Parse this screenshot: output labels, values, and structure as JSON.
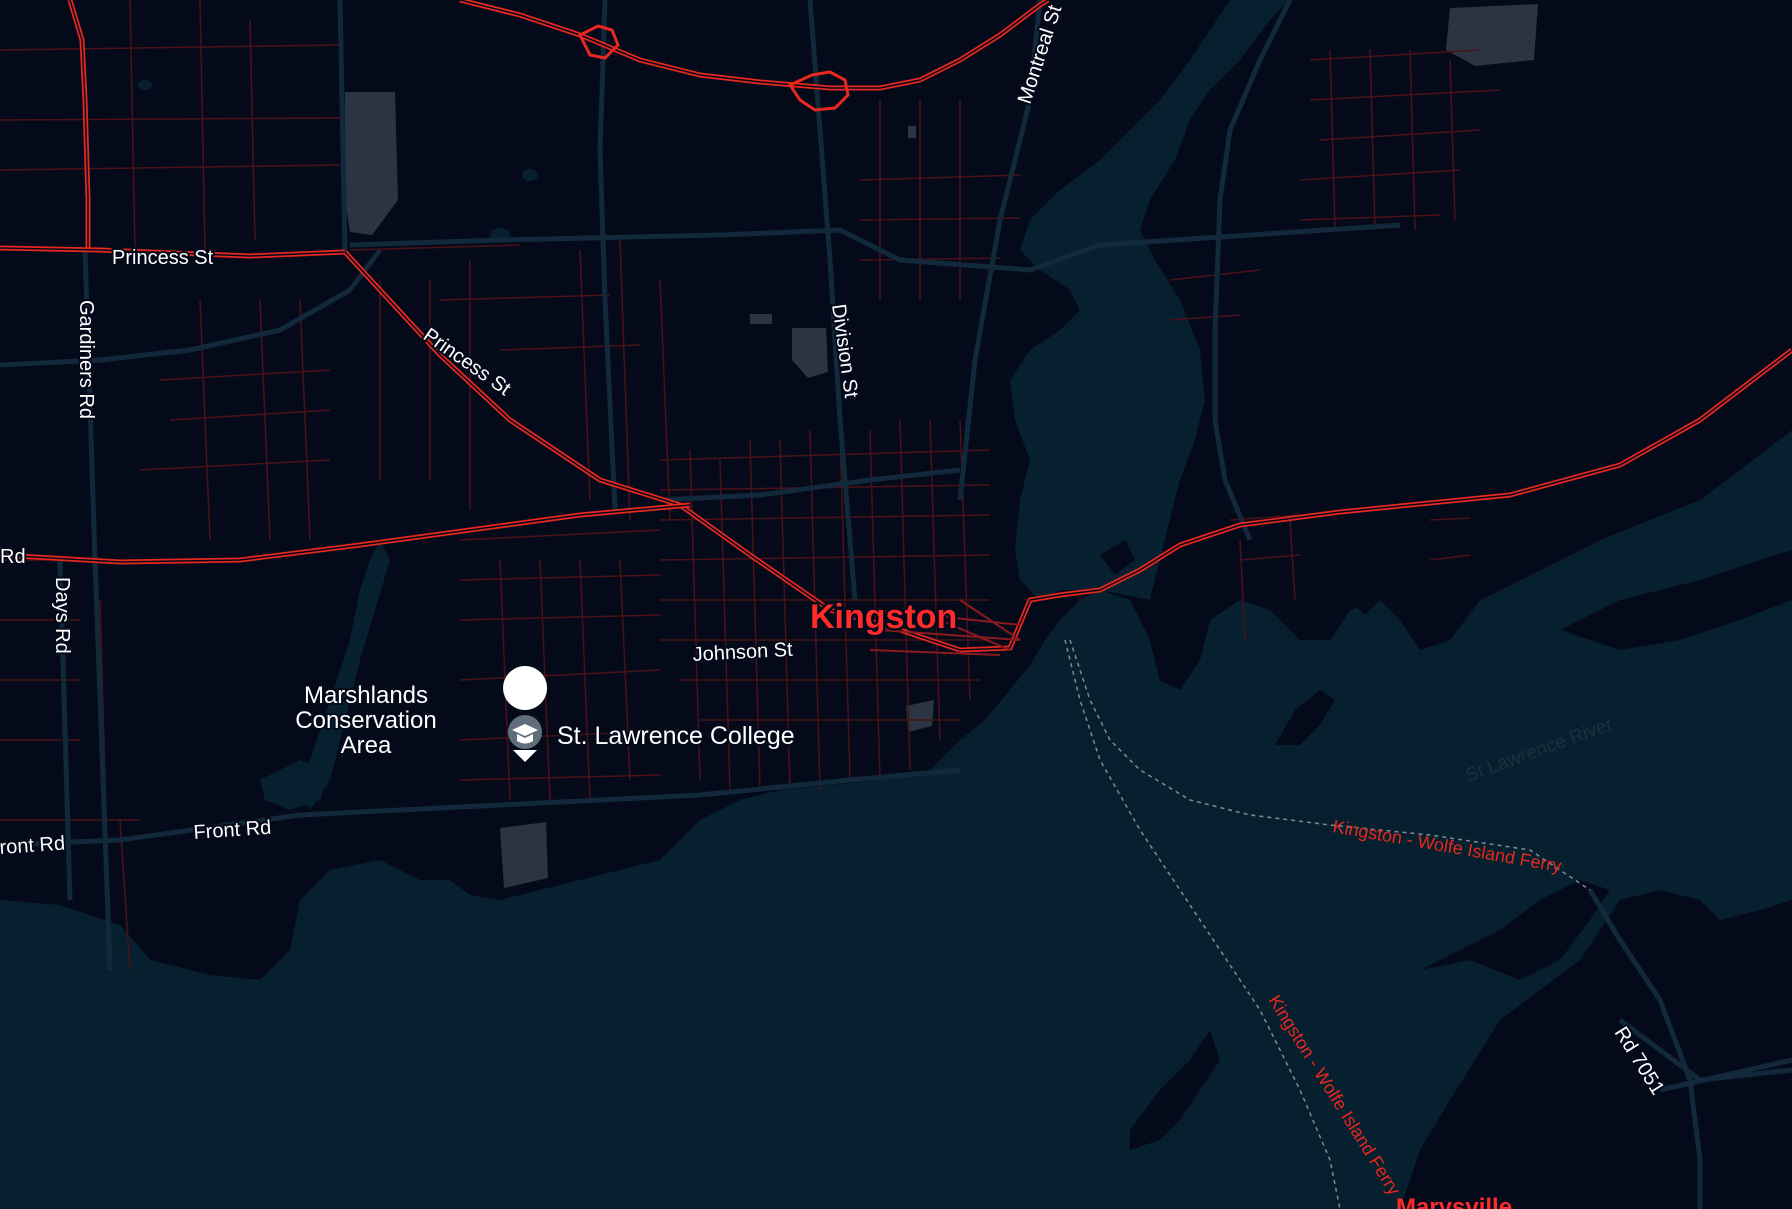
{
  "map": {
    "colors": {
      "land": "#050a1a",
      "water": "#06202f",
      "park": "#2a3442",
      "highway": "#e8271e",
      "highway_edge": "#3a0c0c",
      "minor_road": "#5a1418",
      "arterial": "#11293a",
      "ferry": "#7f8c94",
      "label_white": "#ffffff",
      "label_red": "#ff2a2a"
    },
    "city": {
      "name": "Kingston"
    },
    "streets": {
      "princess_st_west": "Princess St",
      "princess_st_diag": "Princess St",
      "gardiners_rd": "Gardiners Rd",
      "rd_west": "Rd",
      "days_rd": "Days Rd",
      "division_st": "Division St",
      "montreal_st": "Montreal St",
      "johnson_st": "Johnson St",
      "front_rd_west": "ront Rd",
      "front_rd": "Front Rd",
      "rd_7051": "Rd 7051"
    },
    "area": {
      "line1": "Marshlands",
      "line2": "Conservation",
      "line3": "Area"
    },
    "poi": {
      "name": "St. Lawrence College",
      "icon": "graduation-cap-icon"
    },
    "water_labels": {
      "river": "St Lawrence River"
    },
    "ferry": {
      "route_label_1": "Kingston - Wolfe Island Ferry",
      "route_label_2": "Kingston - Wolfe Island Ferry"
    },
    "town": {
      "marysville": "Marysville"
    }
  }
}
